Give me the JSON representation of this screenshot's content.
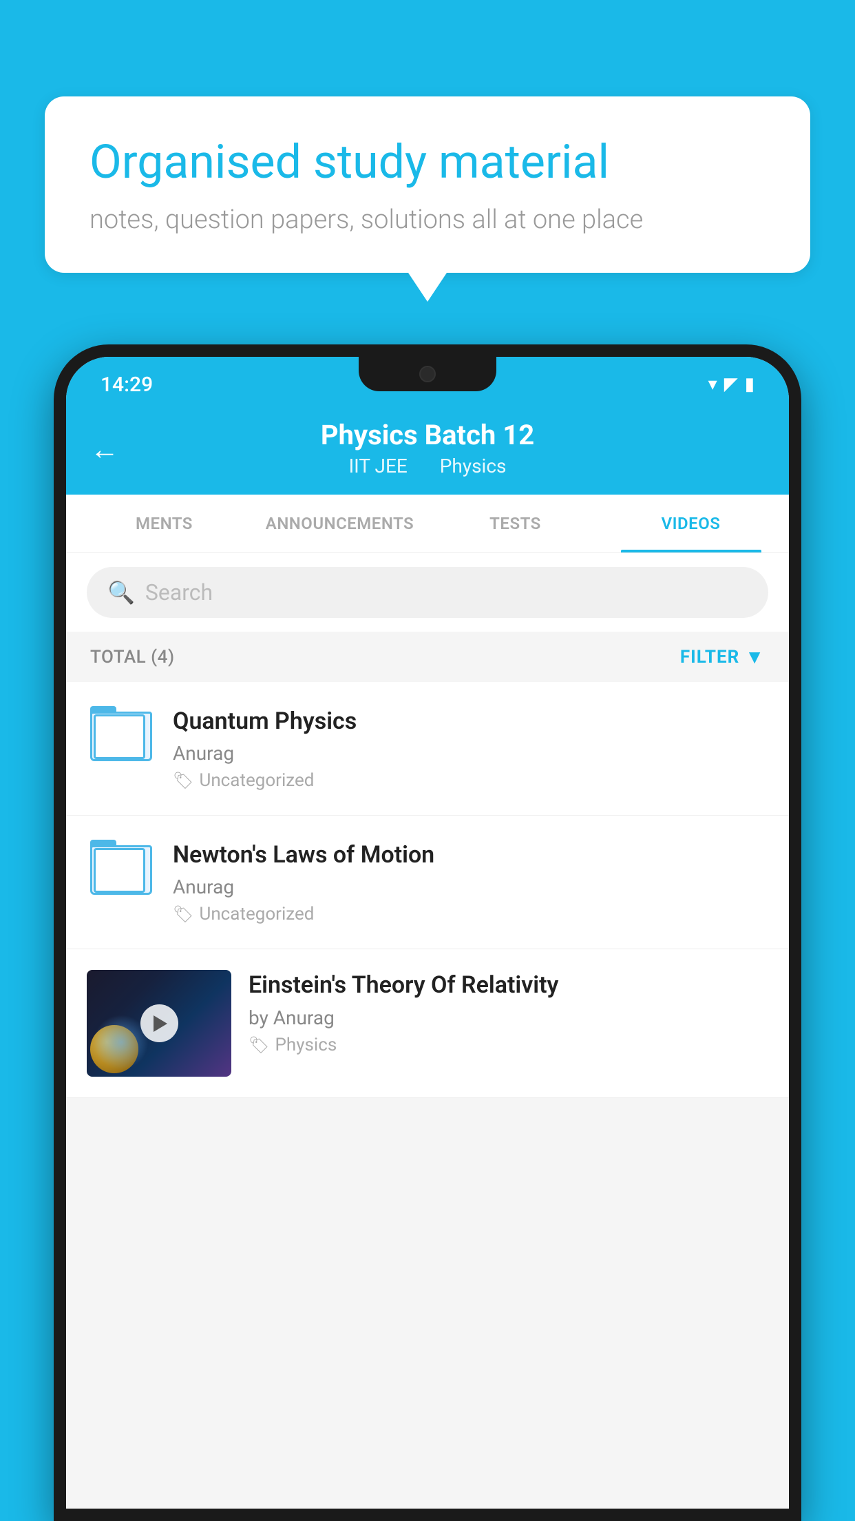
{
  "background_color": "#1ab9e8",
  "bubble": {
    "title": "Organised study material",
    "subtitle": "notes, question papers, solutions all at one place"
  },
  "status_bar": {
    "time": "14:29",
    "wifi": "▾",
    "signal": "▴",
    "battery": "▮"
  },
  "header": {
    "title": "Physics Batch 12",
    "subtitle_1": "IIT JEE",
    "subtitle_2": "Physics",
    "back_label": "←"
  },
  "tabs": [
    {
      "label": "MENTS",
      "active": false
    },
    {
      "label": "ANNOUNCEMENTS",
      "active": false
    },
    {
      "label": "TESTS",
      "active": false
    },
    {
      "label": "VIDEOS",
      "active": true
    }
  ],
  "search": {
    "placeholder": "Search"
  },
  "filter_bar": {
    "total": "TOTAL (4)",
    "filter": "FILTER"
  },
  "videos": [
    {
      "title": "Quantum Physics",
      "author": "Anurag",
      "tag": "Uncategorized",
      "has_thumb": false
    },
    {
      "title": "Newton's Laws of Motion",
      "author": "Anurag",
      "tag": "Uncategorized",
      "has_thumb": false
    },
    {
      "title": "Einstein's Theory Of Relativity",
      "author": "by Anurag",
      "tag": "Physics",
      "has_thumb": true
    }
  ]
}
